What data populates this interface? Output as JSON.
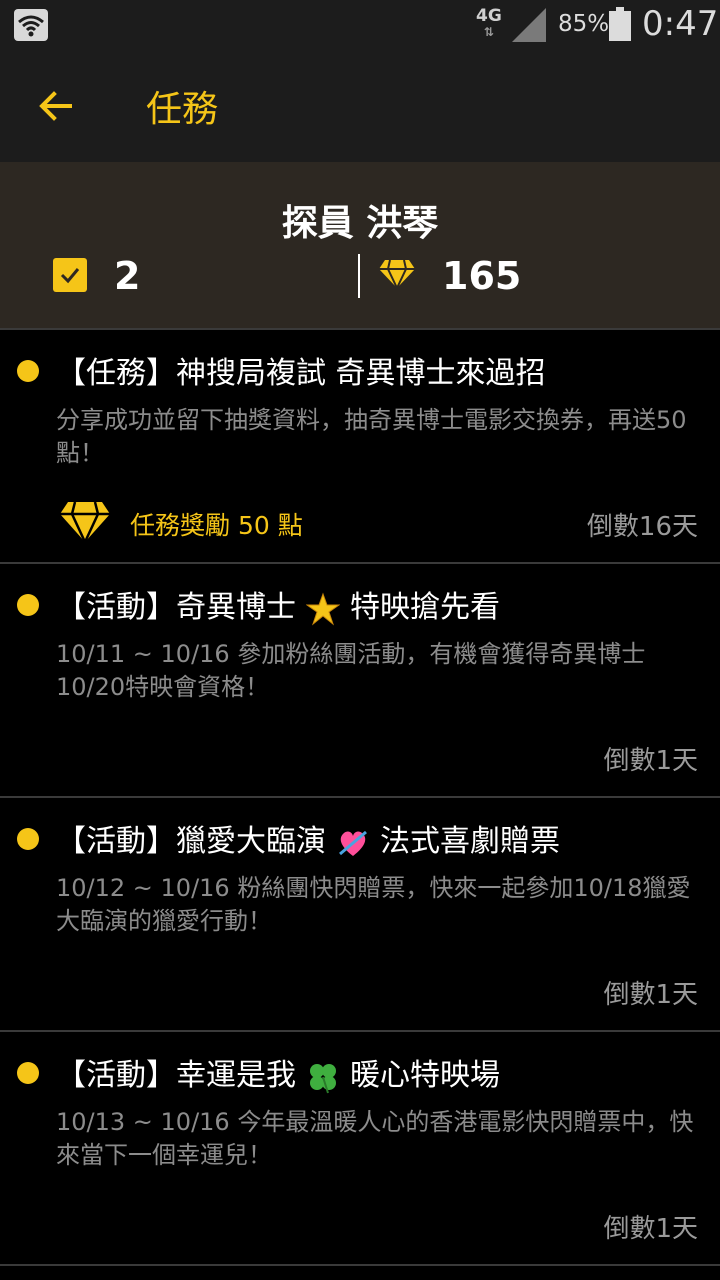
{
  "status_bar": {
    "network": "4G",
    "battery": "85%",
    "time": "0:47"
  },
  "app_bar": {
    "title": "任務",
    "back_icon": "arrow-left-icon"
  },
  "profile": {
    "name": "探員 洪琴",
    "tasks_completed": "2",
    "points": "165"
  },
  "colors": {
    "accent": "#f5c518",
    "header_bg": "#2d2822",
    "bar_bg": "#1c1c1c"
  },
  "items": [
    {
      "title": "【任務】神搜局複試 奇異博士來過招",
      "desc": "分享成功並留下抽獎資料，抽奇異博士電影交換券，再送50點！",
      "reward": "任務獎勵 50 點",
      "countdown": "倒數16天"
    },
    {
      "title_before": "【活動】奇異博士",
      "emoji": "star-icon",
      "title_after": "特映搶先看",
      "desc": "10/11 ~ 10/16 參加粉絲團活動，有機會獲得奇異博士10/20特映會資格！",
      "countdown": "倒數1天"
    },
    {
      "title_before": "【活動】獵愛大臨演",
      "emoji": "heart-arrow-icon",
      "title_after": "法式喜劇贈票",
      "desc": "10/12 ~ 10/16 粉絲團快閃贈票，快來一起參加10/18獵愛大臨演的獵愛行動！",
      "countdown": "倒數1天"
    },
    {
      "title_before": "【活動】幸運是我",
      "emoji": "four-leaf-clover-icon",
      "title_after": "暖心特映場",
      "desc": "10/13 ~ 10/16 今年最溫暖人心的香港電影快閃贈票中，快來當下一個幸運兒！",
      "countdown": "倒數1天"
    }
  ]
}
